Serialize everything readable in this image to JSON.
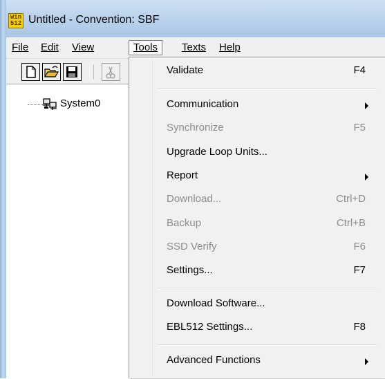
{
  "window": {
    "title": "Untitled - Convention: SBF",
    "icon_text_top": "Win",
    "icon_text_bottom": "512"
  },
  "menubar": {
    "items": [
      {
        "label": "File",
        "accel": "F"
      },
      {
        "label": "Edit",
        "accel": "E"
      },
      {
        "label": "View",
        "accel": "V"
      },
      {
        "label": "Tools",
        "accel": "T",
        "active": true
      },
      {
        "label": "Texts",
        "accel": "T"
      },
      {
        "label": "Help",
        "accel": "H"
      }
    ]
  },
  "toolbar": {
    "buttons": [
      "new-document-icon",
      "open-folder-icon",
      "save-disk-icon",
      "cut-scissors-icon"
    ]
  },
  "tree": {
    "root_label": "System0",
    "root_icon": "network-computers-icon"
  },
  "tools_menu": {
    "items": [
      {
        "label": "Validate",
        "shortcut": "F4",
        "enabled": true
      },
      {
        "label": "Communication",
        "shortcut": "",
        "enabled": true,
        "submenu": true
      },
      {
        "label": "Synchronize",
        "shortcut": "F5",
        "enabled": false
      },
      {
        "label": "Upgrade Loop Units...",
        "shortcut": "",
        "enabled": true
      },
      {
        "label": "Report",
        "shortcut": "",
        "enabled": true,
        "submenu": true
      },
      {
        "label": "Download...",
        "shortcut": "Ctrl+D",
        "enabled": false
      },
      {
        "label": "Backup",
        "shortcut": "Ctrl+B",
        "enabled": false
      },
      {
        "label": "SSD Verify",
        "shortcut": "F6",
        "enabled": false
      },
      {
        "label": "Settings...",
        "shortcut": "F7",
        "enabled": true
      },
      {
        "label": "Download Software...",
        "shortcut": "",
        "enabled": true
      },
      {
        "label": "EBL512 Settings...",
        "shortcut": "F8",
        "enabled": true
      },
      {
        "label": "Advanced Functions",
        "shortcut": "",
        "enabled": true,
        "submenu": true
      }
    ]
  },
  "colors": {
    "disabled_text": "#8c8c8c",
    "menu_background": "#f1f1f1",
    "titlebar": "#bcd3ec"
  }
}
